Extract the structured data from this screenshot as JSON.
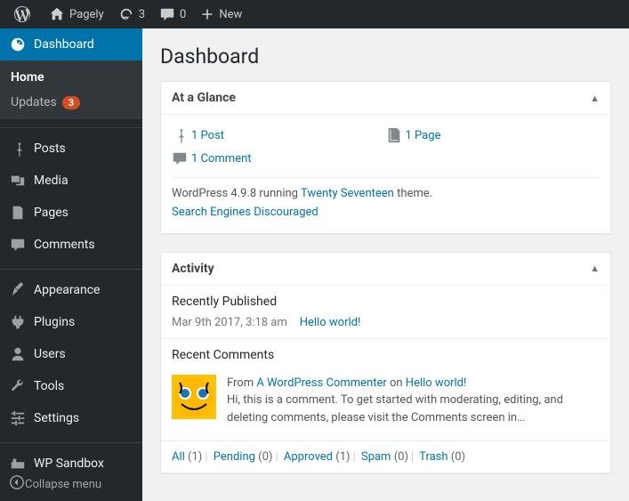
{
  "adminbar": {
    "site_name": "Pagely",
    "updates_count": "3",
    "comments_count": "0",
    "new_label": "New"
  },
  "sidebar": {
    "dashboard": "Dashboard",
    "home": "Home",
    "updates": "Updates",
    "updates_badge": "3",
    "posts": "Posts",
    "media": "Media",
    "pages": "Pages",
    "comments": "Comments",
    "appearance": "Appearance",
    "plugins": "Plugins",
    "users": "Users",
    "tools": "Tools",
    "settings": "Settings",
    "wp_sandbox": "WP Sandbox",
    "collapse": "Collapse menu"
  },
  "page_title": "Dashboard",
  "glance": {
    "title": "At a Glance",
    "posts": "1 Post",
    "pages": "1 Page",
    "comments": "1 Comment",
    "version_prefix": "WordPress 4.9.8 running ",
    "theme_link": "Twenty Seventeen",
    "version_suffix": " theme.",
    "seo": "Search Engines Discouraged"
  },
  "activity": {
    "title": "Activity",
    "recently_published": "Recently Published",
    "pub_date": "Mar 9th 2017, 3:18 am",
    "pub_title": "Hello world!",
    "recent_comments": "Recent Comments",
    "comment_from": "From ",
    "comment_author": "A WordPress Commenter",
    "comment_on": " on ",
    "comment_post": "Hello world!",
    "comment_body": "Hi, this is a comment. To get started with moderating, editing, and deleting comments, please visit the Comments screen in…",
    "filters": {
      "all": "All",
      "all_n": "(1)",
      "pending": "Pending",
      "pending_n": "(0)",
      "approved": "Approved",
      "approved_n": "(1)",
      "spam": "Spam",
      "spam_n": "(0)",
      "trash": "Trash",
      "trash_n": "(0)"
    }
  }
}
